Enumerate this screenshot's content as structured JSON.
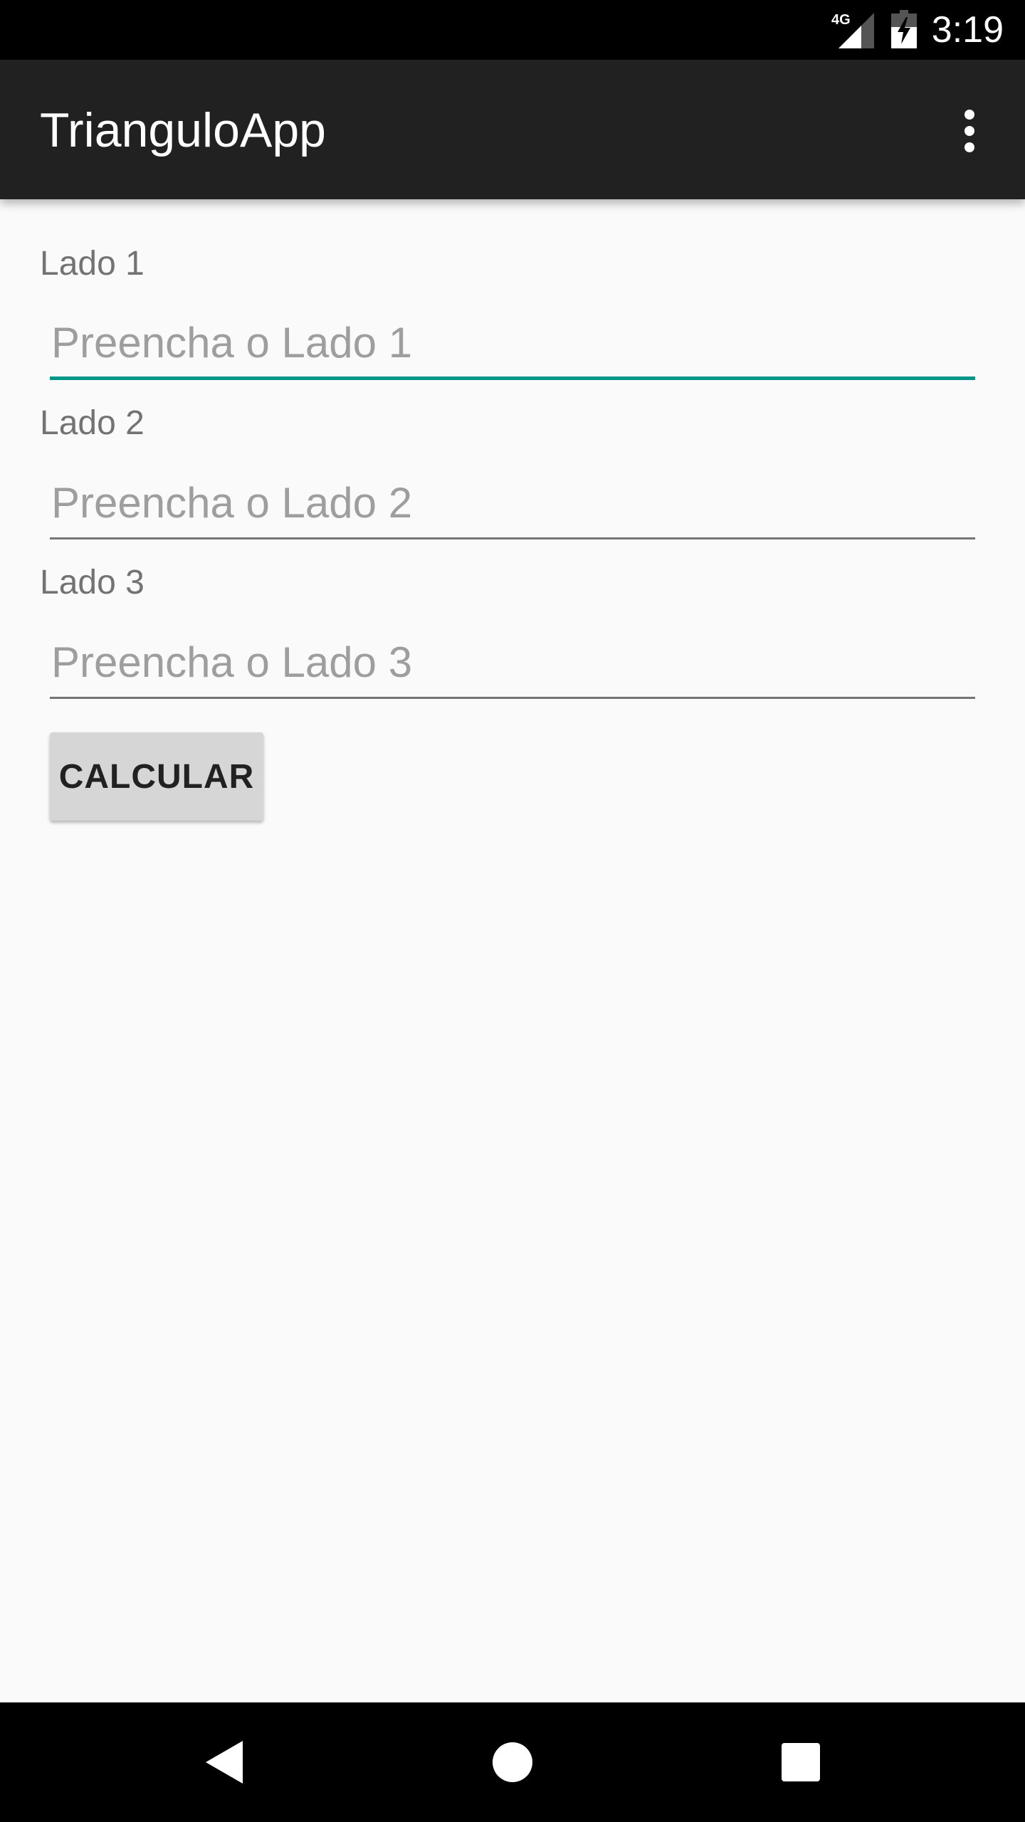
{
  "status_bar": {
    "network": "4G",
    "time": "3:19"
  },
  "app_bar": {
    "title": "TrianguloApp",
    "overflow_icon": "more-vert-icon"
  },
  "form": {
    "fields": [
      {
        "label": "Lado 1",
        "value": "",
        "placeholder": "Preencha o Lado 1",
        "focused": true
      },
      {
        "label": "Lado 2",
        "value": "",
        "placeholder": "Preencha o Lado 2",
        "focused": false
      },
      {
        "label": "Lado 3",
        "value": "",
        "placeholder": "Preencha o Lado 3",
        "focused": false
      }
    ],
    "calculate_label": "CALCULAR"
  },
  "nav_bar": {
    "icons": [
      "back-icon",
      "home-icon",
      "recents-icon"
    ]
  },
  "colors": {
    "accent": "#009688",
    "app_bar": "#212121",
    "background": "#fafafa"
  }
}
